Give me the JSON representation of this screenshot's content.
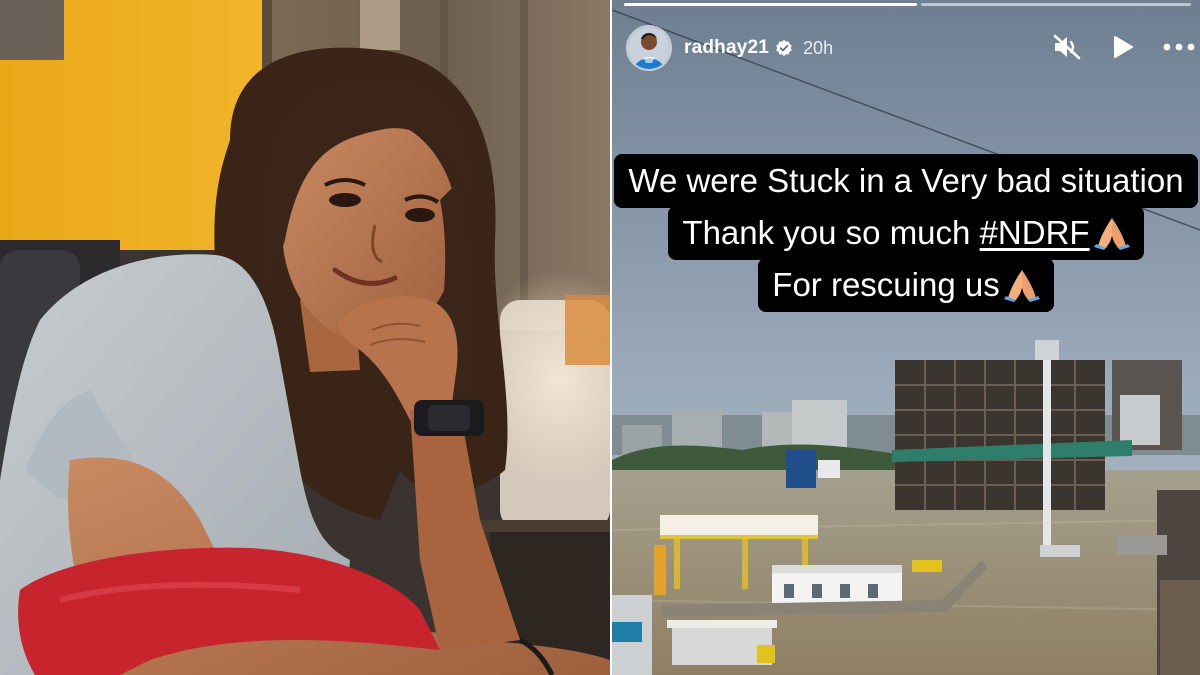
{
  "story": {
    "username": "radhay21",
    "time_ago": "20h",
    "caption": {
      "line1": "We were Stuck in a Very bad situation",
      "line2_prefix": "Thank you so much ",
      "hashtag": "#NDRF",
      "line3": "For rescuing us"
    }
  },
  "icons": {
    "verified": "verified-badge-icon",
    "mute": "speaker-muted-icon",
    "play": "play-icon",
    "more": "more-options-icon",
    "emoji": "folded-hands-emoji"
  },
  "colors": {
    "wall_yellow": "#e8a81c",
    "pillow_red": "#c8242e",
    "sky": "#8fa0b2",
    "flood_water": "#a69a80"
  }
}
